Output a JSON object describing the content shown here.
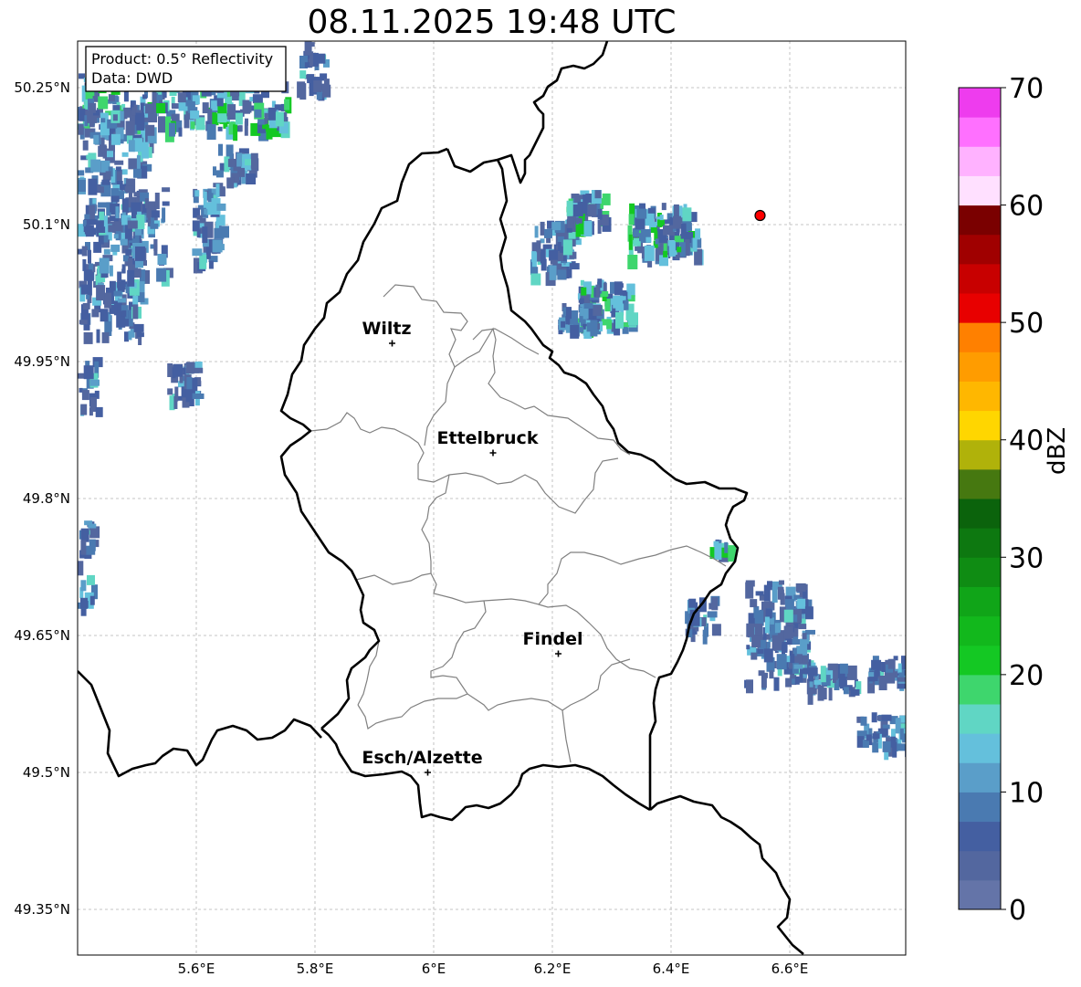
{
  "title": "08.11.2025 19:48 UTC",
  "info_box": {
    "product": "Product: 0.5° Reflectivity",
    "data": "Data: DWD"
  },
  "cities": [
    {
      "name": "Wiltz",
      "lon": 5.93,
      "lat": 49.97
    },
    {
      "name": "Ettelbruck",
      "lon": 6.1,
      "lat": 49.85
    },
    {
      "name": "Findel",
      "lon": 6.21,
      "lat": 49.63
    },
    {
      "name": "Esch/Alzette",
      "lon": 5.99,
      "lat": 49.5
    }
  ],
  "radar_site": {
    "lon": 6.55,
    "lat": 50.11
  },
  "x_ticks": [
    "5.6°E",
    "5.8°E",
    "6°E",
    "6.2°E",
    "6.4°E",
    "6.6°E"
  ],
  "y_ticks": [
    "50.25°N",
    "50.1°N",
    "49.95°N",
    "49.8°N",
    "49.65°N",
    "49.5°N",
    "49.35°N"
  ],
  "colorbar": {
    "label": "dBZ",
    "min": 0,
    "max": 70,
    "step": 2.5,
    "tick_labels": [
      "0",
      "10",
      "20",
      "30",
      "40",
      "50",
      "60",
      "70"
    ],
    "colors": [
      "#6474a8",
      "#53679f",
      "#445fa1",
      "#4a7ab1",
      "#5a9ec9",
      "#64c0dc",
      "#60d6c4",
      "#3ed66d",
      "#14c823",
      "#12b81c",
      "#10a518",
      "#0f8c13",
      "#0d7810",
      "#0b630c",
      "#467810",
      "#b0b20a",
      "#ffd600",
      "#ffb700",
      "#ff9c00",
      "#ff8000",
      "#e80000",
      "#c80000",
      "#a00000",
      "#7a0000",
      "#ffe0ff",
      "#ffb2ff",
      "#ff70ff",
      "#ee3cee"
    ]
  },
  "colors": {
    "border_international": "#000000",
    "border_internal": "#808080",
    "grid": "#b4b4b4",
    "radar_marker": "#ff0000"
  }
}
